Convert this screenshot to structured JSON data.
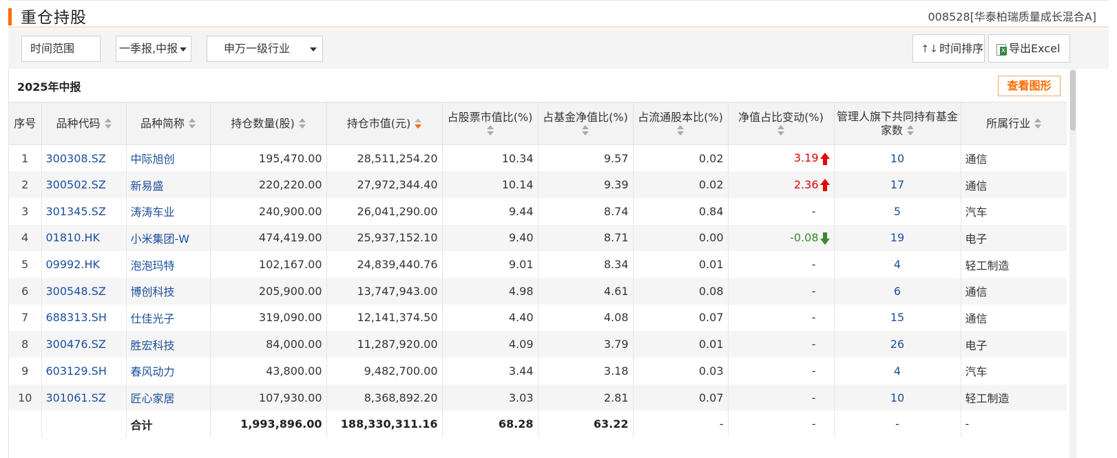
{
  "header": {
    "title": "重仓持股",
    "fund_name": "008528[华泰柏瑞质量成长混合A]"
  },
  "toolbar": {
    "time_range_label": "时间范围",
    "report_select_value": "一季报,中报",
    "industry_select_value": "申万一级行业",
    "time_sort_label": "时间排序",
    "time_sort_icon": "↑↓",
    "export_label": "导出Excel"
  },
  "panel": {
    "period_label": "2025年中报",
    "view_chart_label": "查看图形"
  },
  "table": {
    "headers": {
      "index": "序号",
      "code": "品种代码",
      "name": "品种简称",
      "quantity": "持仓数量(股)",
      "market_value": "持仓市值(元)",
      "stock_ratio": "占股票市值比(%)",
      "nav_ratio": "占基金净值比(%)",
      "float_ratio": "占流通股本比(%)",
      "nav_change": "净值占比变动(%)",
      "manager_count": "管理人旗下共同持有基金家数",
      "industry": "所属行业"
    },
    "rows": [
      {
        "index": "1",
        "code": "300308.SZ",
        "name": "中际旭创",
        "quantity": "195,470.00",
        "market_value": "28,511,254.20",
        "stock_ratio": "10.34",
        "nav_ratio": "9.57",
        "float_ratio": "0.02",
        "nav_change": "3.19",
        "change_dir": "up",
        "manager_count": "10",
        "industry": "通信"
      },
      {
        "index": "2",
        "code": "300502.SZ",
        "name": "新易盛",
        "quantity": "220,220.00",
        "market_value": "27,972,344.40",
        "stock_ratio": "10.14",
        "nav_ratio": "9.39",
        "float_ratio": "0.02",
        "nav_change": "2.36",
        "change_dir": "up",
        "manager_count": "17",
        "industry": "通信"
      },
      {
        "index": "3",
        "code": "301345.SZ",
        "name": "涛涛车业",
        "quantity": "240,900.00",
        "market_value": "26,041,290.00",
        "stock_ratio": "9.44",
        "nav_ratio": "8.74",
        "float_ratio": "0.84",
        "nav_change": "-",
        "change_dir": "none",
        "manager_count": "5",
        "industry": "汽车"
      },
      {
        "index": "4",
        "code": "01810.HK",
        "name": "小米集团-W",
        "quantity": "474,419.00",
        "market_value": "25,937,152.10",
        "stock_ratio": "9.40",
        "nav_ratio": "8.71",
        "float_ratio": "0.00",
        "nav_change": "-0.08",
        "change_dir": "down",
        "manager_count": "19",
        "industry": "电子"
      },
      {
        "index": "5",
        "code": "09992.HK",
        "name": "泡泡玛特",
        "quantity": "102,167.00",
        "market_value": "24,839,440.76",
        "stock_ratio": "9.01",
        "nav_ratio": "8.34",
        "float_ratio": "0.01",
        "nav_change": "-",
        "change_dir": "none",
        "manager_count": "4",
        "industry": "轻工制造"
      },
      {
        "index": "6",
        "code": "300548.SZ",
        "name": "博创科技",
        "quantity": "205,900.00",
        "market_value": "13,747,943.00",
        "stock_ratio": "4.98",
        "nav_ratio": "4.61",
        "float_ratio": "0.08",
        "nav_change": "-",
        "change_dir": "none",
        "manager_count": "6",
        "industry": "通信"
      },
      {
        "index": "7",
        "code": "688313.SH",
        "name": "仕佳光子",
        "quantity": "319,090.00",
        "market_value": "12,141,374.50",
        "stock_ratio": "4.40",
        "nav_ratio": "4.08",
        "float_ratio": "0.07",
        "nav_change": "-",
        "change_dir": "none",
        "manager_count": "15",
        "industry": "通信"
      },
      {
        "index": "8",
        "code": "300476.SZ",
        "name": "胜宏科技",
        "quantity": "84,000.00",
        "market_value": "11,287,920.00",
        "stock_ratio": "4.09",
        "nav_ratio": "3.79",
        "float_ratio": "0.01",
        "nav_change": "-",
        "change_dir": "none",
        "manager_count": "26",
        "industry": "电子"
      },
      {
        "index": "9",
        "code": "603129.SH",
        "name": "春风动力",
        "quantity": "43,800.00",
        "market_value": "9,482,700.00",
        "stock_ratio": "3.44",
        "nav_ratio": "3.18",
        "float_ratio": "0.03",
        "nav_change": "-",
        "change_dir": "none",
        "manager_count": "4",
        "industry": "汽车"
      },
      {
        "index": "10",
        "code": "301061.SZ",
        "name": "匠心家居",
        "quantity": "107,930.00",
        "market_value": "8,368,892.20",
        "stock_ratio": "3.03",
        "nav_ratio": "2.81",
        "float_ratio": "0.07",
        "nav_change": "-",
        "change_dir": "none",
        "manager_count": "10",
        "industry": "轻工制造"
      }
    ],
    "total": {
      "label": "合计",
      "quantity": "1,993,896.00",
      "market_value": "188,330,311.16",
      "stock_ratio": "68.28",
      "nav_ratio": "63.22",
      "float_ratio": "-",
      "nav_change": "-",
      "manager_count": "-",
      "industry": "-"
    }
  },
  "colors": {
    "accent": "#ff6a00",
    "link": "#1a4e9e",
    "up": "#e60000",
    "down": "#3a8a2a"
  }
}
